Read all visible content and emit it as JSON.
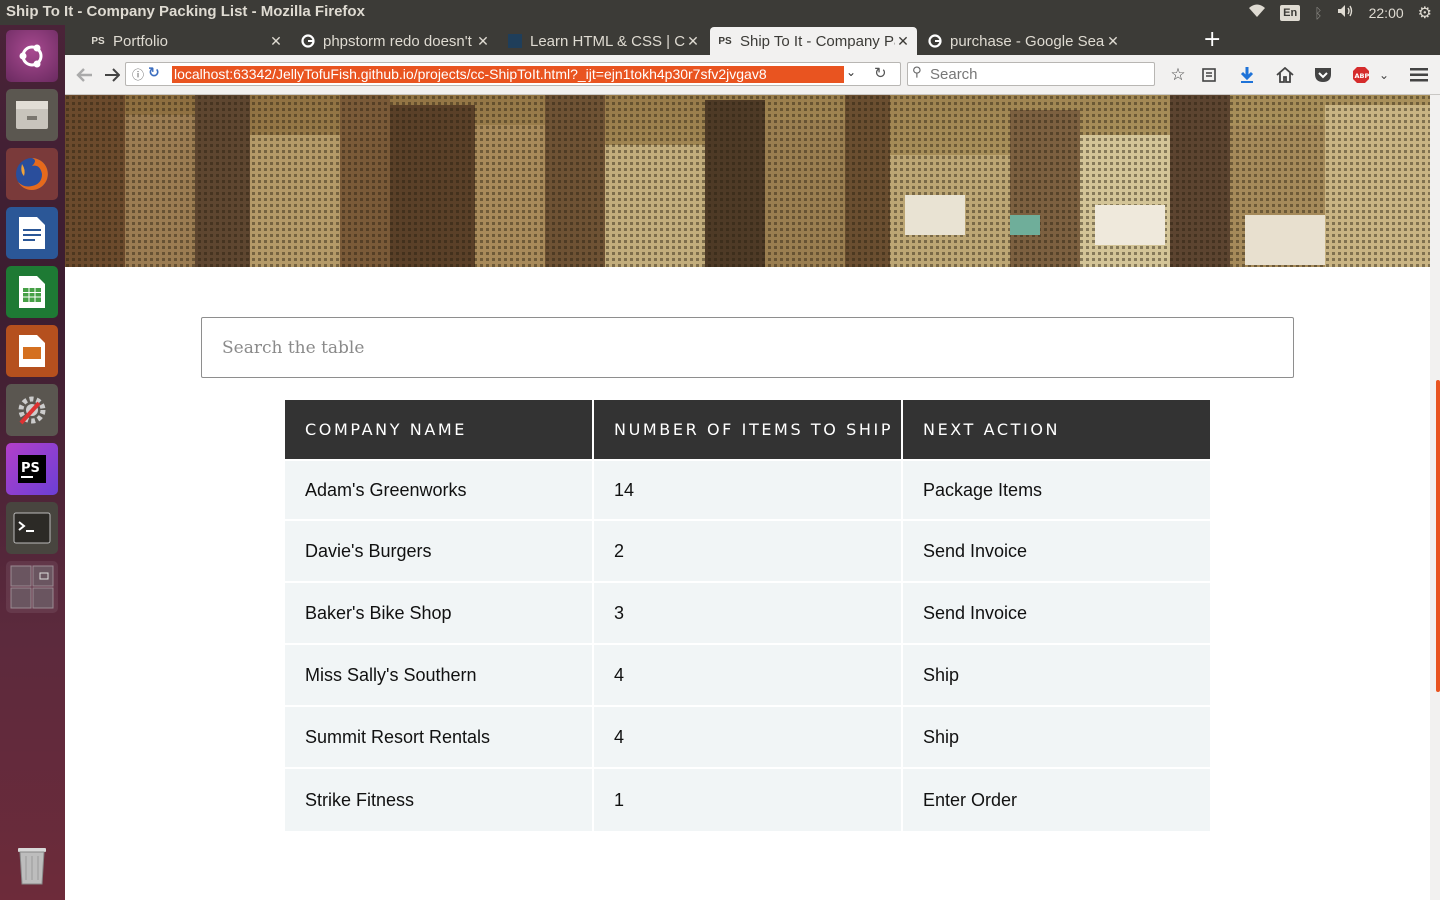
{
  "window": {
    "title": "Ship To It - Company Packing List - Mozilla Firefox"
  },
  "tray": {
    "language": "En",
    "clock": "22:00"
  },
  "tabs": [
    {
      "label": "Portfolio",
      "icon": "phpstorm-icon",
      "active": false
    },
    {
      "label": "phpstorm redo doesn't",
      "icon": "google-icon",
      "active": false
    },
    {
      "label": "Learn HTML & CSS | Codecademy",
      "icon": "codecademy-icon",
      "active": false
    },
    {
      "label": "Ship To It - Company Packing List",
      "icon": "phpstorm-icon",
      "active": true
    },
    {
      "label": "purchase - Google Search",
      "icon": "google-icon",
      "active": false
    }
  ],
  "nav": {
    "url": "localhost:63342/JellyTofuFish.github.io/projects/cc-ShipToIt.html?_ijt=ejn1tokh4p30r7sfv2jvgav8",
    "search_placeholder": "Search"
  },
  "page": {
    "search_placeholder": "Search the table",
    "table": {
      "headers": [
        "COMPANY NAME",
        "NUMBER OF ITEMS TO SHIP",
        "NEXT ACTION"
      ],
      "rows": [
        [
          "Adam's Greenworks",
          "14",
          "Package Items"
        ],
        [
          "Davie's Burgers",
          "2",
          "Send Invoice"
        ],
        [
          "Baker's Bike Shop",
          "3",
          "Send Invoice"
        ],
        [
          "Miss Sally's Southern",
          "4",
          "Ship"
        ],
        [
          "Summit Resort Rentals",
          "4",
          "Ship"
        ],
        [
          "Strike Fitness",
          "1",
          "Enter Order"
        ]
      ]
    }
  },
  "colors": {
    "ubuntu_orange": "#e95420",
    "table_header": "#333333",
    "table_cell": "#f1f5f6"
  }
}
